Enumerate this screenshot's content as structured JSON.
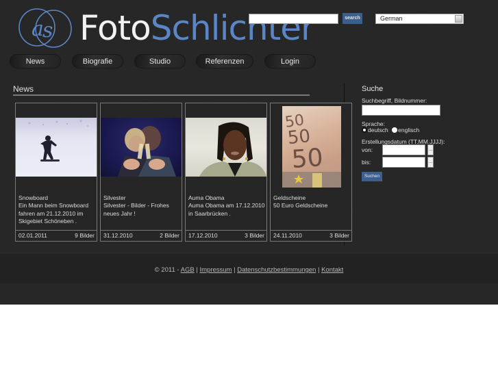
{
  "brand": {
    "part1": "Foto",
    "part2": "Schlichter",
    "monogram": "as"
  },
  "top": {
    "search_placeholder": "",
    "search_value": "",
    "search_button": "search",
    "language_selected": "German"
  },
  "nav": [
    {
      "label": "News"
    },
    {
      "label": "Biografie"
    },
    {
      "label": "Studio"
    },
    {
      "label": "Referenzen"
    },
    {
      "label": "Login"
    }
  ],
  "news": {
    "title": "News",
    "cards": [
      {
        "title": "Snowboard",
        "text": "Ein Mann beim Snowboard fahren am 21.12.2010 im Skigebiet Schöneben .",
        "date": "02.01.2011",
        "count": "9 Bilder",
        "image": "snowboarder"
      },
      {
        "title": "Silvester",
        "text": "Silvester - Bilder - Frohes neues Jahr !",
        "date": "31.12.2010",
        "count": "2 Bilder",
        "image": "couple-toasting-champagne"
      },
      {
        "title": "Auma Obama",
        "text": "Auma Obama am 17.12.2010 in Saarbrücken .",
        "date": "17.12.2010",
        "count": "3 Bilder",
        "image": "portrait-woman"
      },
      {
        "title": "Geldscheine",
        "text": "50 Euro Geldscheine",
        "date": "24.11.2010",
        "count": "3 Bilder",
        "image": "euro-banknotes"
      }
    ]
  },
  "search": {
    "heading": "Suche",
    "term_label": "Suchbegriff, Bildnummer:",
    "term_value": "",
    "language_label": "Sprache:",
    "lang_options": [
      {
        "label": "deutsch",
        "checked": true
      },
      {
        "label": "englisch",
        "checked": false
      }
    ],
    "date_label": "Erstellungsdatum (TT.MM.JJJJ):",
    "from_label": "von:",
    "to_label": "bis:",
    "picker_label": "...",
    "submit": "Suchen"
  },
  "footer": {
    "copyright": "© 2011 - ",
    "links": [
      "AGB",
      "Impressum",
      "Datenschutzbestimmungen",
      "Kontakt"
    ],
    "separator": " | "
  }
}
